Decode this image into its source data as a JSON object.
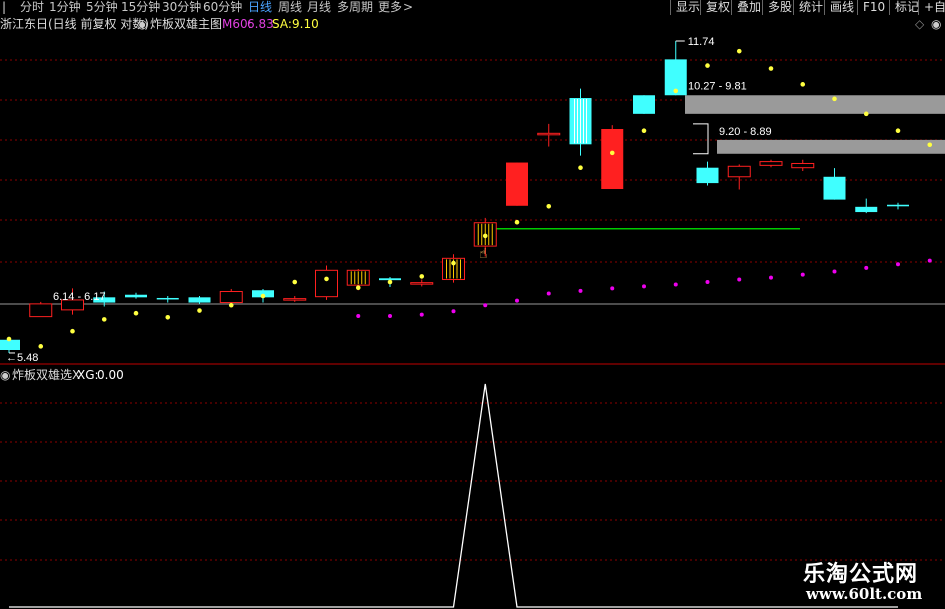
{
  "timeframes": [
    "分时",
    "1分钟",
    "5分钟",
    "15分钟",
    "30分钟",
    "60分钟",
    "日线",
    "周线",
    "月线",
    "多周期",
    "更多"
  ],
  "active_timeframe": "日线",
  "more_chevron": ">",
  "toolbar": [
    "显示",
    "复权",
    "叠加",
    "多股",
    "统计",
    "画线",
    "F10",
    "标记",
    "+自"
  ],
  "stock_title": "浙江东日(日线 前复权 对数)",
  "main_indicator": {
    "name": "炸板双雄主图",
    "ma_label": "M60:",
    "ma_value": "6.83",
    "sa_label": "SA:",
    "sa_value": "9.10"
  },
  "sub_indicator": {
    "name": "炸板双雄选X",
    "xg_label": "XG:",
    "xg_value": "0.00"
  },
  "price_labels": {
    "high": "11.74",
    "low": "5.48",
    "zone1": "10.27 - 9.81",
    "zone2": "9.20 - 8.89",
    "zone3": "6.14 - 6.17"
  },
  "colors": {
    "up": "#ff2020",
    "down": "#40ffff",
    "gold_dots": "#ffff40",
    "magenta_dots": "#ee00ee",
    "grid": "#8c0000",
    "support": "#00cc00",
    "xg_line": "#ffffff"
  },
  "chart_data": [
    {
      "type": "candlestick",
      "title": "炸板双雄主图",
      "ohlc": [
        [
          5.62,
          5.66,
          5.44,
          5.48
        ],
        [
          5.95,
          6.17,
          5.95,
          6.14
        ],
        [
          6.05,
          6.38,
          5.98,
          6.2
        ],
        [
          6.24,
          6.33,
          6.1,
          6.16
        ],
        [
          6.28,
          6.31,
          6.22,
          6.24
        ],
        [
          6.23,
          6.26,
          6.16,
          6.21
        ],
        [
          6.24,
          6.26,
          6.14,
          6.16
        ],
        [
          6.16,
          6.37,
          6.14,
          6.33
        ],
        [
          6.35,
          6.37,
          6.16,
          6.24
        ],
        [
          6.22,
          6.26,
          6.17,
          6.22
        ],
        [
          6.25,
          6.75,
          6.2,
          6.67
        ],
        [
          6.43,
          6.69,
          6.35,
          6.67
        ],
        [
          6.54,
          6.56,
          6.4,
          6.51
        ],
        [
          6.47,
          6.52,
          6.41,
          6.47
        ],
        [
          6.52,
          6.94,
          6.47,
          6.87
        ],
        [
          7.08,
          7.59,
          6.9,
          7.5
        ],
        [
          7.82,
          8.7,
          7.82,
          8.7
        ],
        [
          9.35,
          9.57,
          9.05,
          9.35
        ],
        [
          10.2,
          10.44,
          8.85,
          9.1
        ],
        [
          8.15,
          9.54,
          8.15,
          9.45
        ],
        [
          10.27,
          10.27,
          9.81,
          9.81
        ],
        [
          11.22,
          11.74,
          10.27,
          10.27
        ],
        [
          8.59,
          8.72,
          8.22,
          8.27
        ],
        [
          8.4,
          8.66,
          8.14,
          8.62
        ],
        [
          8.64,
          8.76,
          8.6,
          8.72
        ],
        [
          8.59,
          8.76,
          8.52,
          8.68
        ],
        [
          8.4,
          8.58,
          7.94,
          7.94
        ],
        [
          7.8,
          7.96,
          7.68,
          7.7
        ],
        [
          7.84,
          7.88,
          7.75,
          7.81
        ]
      ],
      "gold_dots": [
        5.63,
        5.53,
        5.74,
        5.91,
        6.0,
        5.94,
        6.04,
        6.12,
        6.26,
        6.48,
        6.53,
        6.39,
        6.48,
        6.57,
        6.79,
        7.26,
        7.51,
        7.81,
        8.59,
        8.91,
        9.41,
        10.38,
        11.05,
        11.45,
        10.97,
        10.55,
        10.18,
        9.81,
        9.41,
        9.09
      ],
      "magenta_dots": [
        5.96,
        5.96,
        5.98,
        6.03,
        6.12,
        6.19,
        6.3,
        6.34,
        6.38,
        6.41,
        6.44,
        6.48,
        6.52,
        6.55,
        6.6,
        6.65,
        6.71,
        6.77,
        6.83
      ],
      "support_line": 7.39
    },
    {
      "type": "line",
      "title": "炸板双雄选X",
      "series": [
        {
          "name": "XG",
          "values": [
            0,
            0,
            0,
            0,
            0,
            0,
            0,
            0,
            0,
            0,
            0,
            0,
            0,
            0,
            0,
            1,
            0,
            0,
            0,
            0,
            0,
            0,
            0,
            0,
            0,
            0,
            0,
            0,
            0
          ]
        }
      ],
      "ylim": [
        0,
        1
      ]
    }
  ]
}
